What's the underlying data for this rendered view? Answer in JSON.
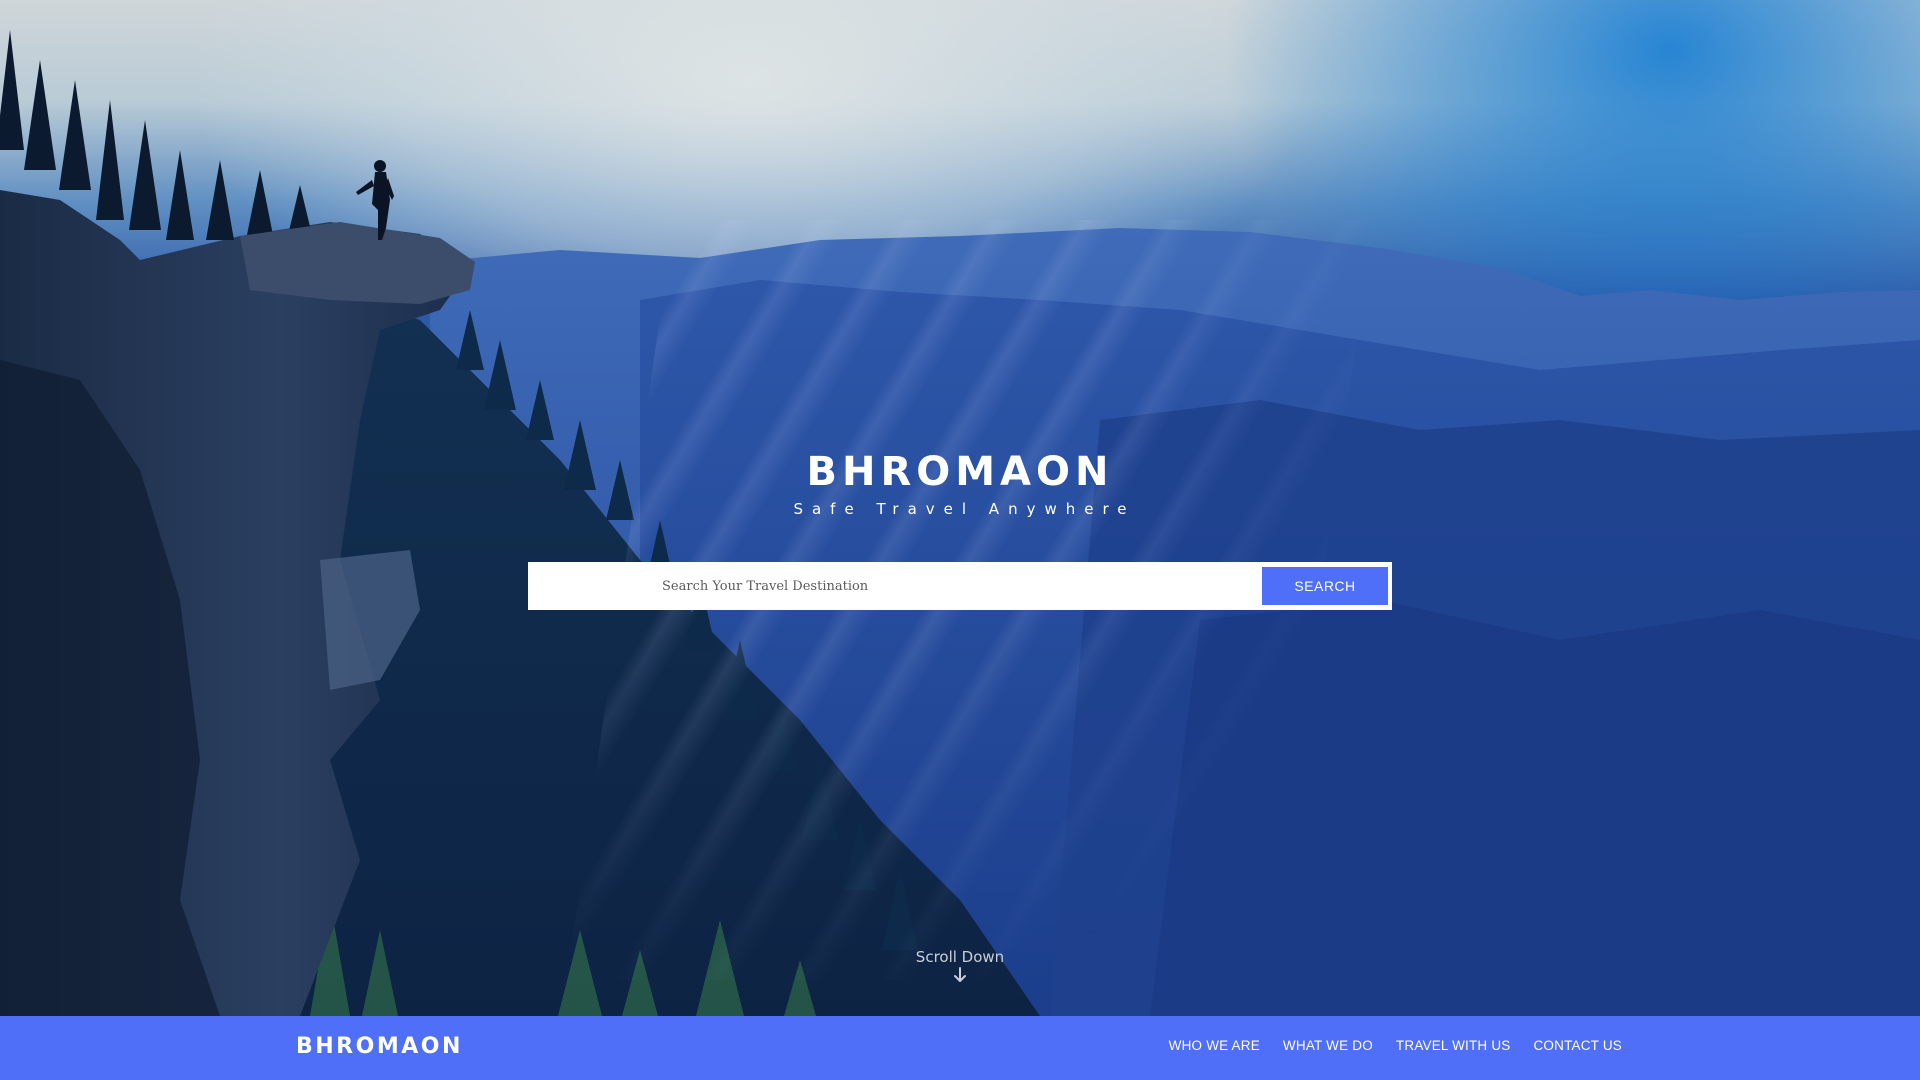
{
  "hero": {
    "brand_title": "BHROMAON",
    "tagline": "Safe Travel Anywhere",
    "scroll_label": "Scroll Down"
  },
  "search": {
    "placeholder": "Search Your Travel Destination",
    "value": "",
    "button_label": "SEARCH"
  },
  "navbar": {
    "logo": "BHROMAON",
    "links": [
      "WHO WE ARE",
      "WHAT WE DO",
      "TRAVEL WITH US",
      "CONTACT US"
    ]
  },
  "colors": {
    "accent": "#4f6ff8",
    "text_light": "#ffffff"
  },
  "icons": {
    "scroll": "arrow-down-icon"
  }
}
